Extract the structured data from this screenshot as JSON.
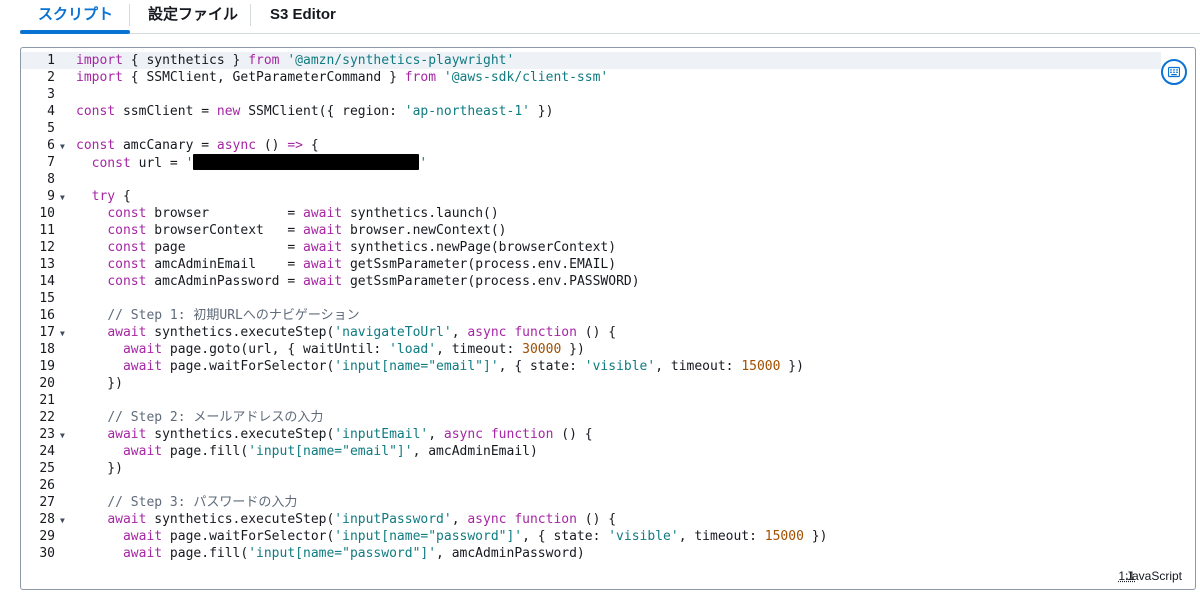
{
  "tabs": [
    {
      "label": "スクリプト",
      "active": true
    },
    {
      "label": "設定ファイル",
      "active": false
    },
    {
      "label": "S3 Editor",
      "active": false
    }
  ],
  "editor": {
    "lines": [
      {
        "n": "1",
        "fold": false,
        "parts": [
          [
            "kw",
            "import"
          ],
          [
            "p",
            " { synthetics } "
          ],
          [
            "kw",
            "from"
          ],
          [
            "p",
            " "
          ],
          [
            "str",
            "'@amzn/synthetics-playwright'"
          ]
        ]
      },
      {
        "n": "2",
        "fold": false,
        "parts": [
          [
            "kw",
            "import"
          ],
          [
            "p",
            " { SSMClient, GetParameterCommand } "
          ],
          [
            "kw",
            "from"
          ],
          [
            "p",
            " "
          ],
          [
            "str",
            "'@aws-sdk/client-ssm'"
          ]
        ]
      },
      {
        "n": "3",
        "fold": false,
        "parts": []
      },
      {
        "n": "4",
        "fold": false,
        "parts": [
          [
            "kw",
            "const"
          ],
          [
            "p",
            " ssmClient = "
          ],
          [
            "kw",
            "new"
          ],
          [
            "p",
            " SSMClient({ region: "
          ],
          [
            "str",
            "'ap-northeast-1'"
          ],
          [
            "p",
            " })"
          ]
        ]
      },
      {
        "n": "5",
        "fold": false,
        "parts": []
      },
      {
        "n": "6",
        "fold": true,
        "parts": [
          [
            "kw",
            "const"
          ],
          [
            "p",
            " amcCanary = "
          ],
          [
            "kw",
            "async"
          ],
          [
            "p",
            " () "
          ],
          [
            "kw",
            "=>"
          ],
          [
            "p",
            " {"
          ]
        ]
      },
      {
        "n": "7",
        "fold": false,
        "parts": [
          [
            "p",
            "  "
          ],
          [
            "kw",
            "const"
          ],
          [
            "p",
            " url = "
          ],
          [
            "str",
            "'"
          ],
          [
            "redact",
            ""
          ],
          [
            "str",
            "'"
          ]
        ]
      },
      {
        "n": "8",
        "fold": false,
        "parts": []
      },
      {
        "n": "9",
        "fold": true,
        "parts": [
          [
            "p",
            "  "
          ],
          [
            "kw",
            "try"
          ],
          [
            "p",
            " {"
          ]
        ]
      },
      {
        "n": "10",
        "fold": false,
        "parts": [
          [
            "p",
            "    "
          ],
          [
            "kw",
            "const"
          ],
          [
            "p",
            " browser          = "
          ],
          [
            "kw",
            "await"
          ],
          [
            "p",
            " synthetics.launch()"
          ]
        ]
      },
      {
        "n": "11",
        "fold": false,
        "parts": [
          [
            "p",
            "    "
          ],
          [
            "kw",
            "const"
          ],
          [
            "p",
            " browserContext   = "
          ],
          [
            "kw",
            "await"
          ],
          [
            "p",
            " browser.newContext()"
          ]
        ]
      },
      {
        "n": "12",
        "fold": false,
        "parts": [
          [
            "p",
            "    "
          ],
          [
            "kw",
            "const"
          ],
          [
            "p",
            " page             = "
          ],
          [
            "kw",
            "await"
          ],
          [
            "p",
            " synthetics.newPage(browserContext)"
          ]
        ]
      },
      {
        "n": "13",
        "fold": false,
        "parts": [
          [
            "p",
            "    "
          ],
          [
            "kw",
            "const"
          ],
          [
            "p",
            " amcAdminEmail    = "
          ],
          [
            "kw",
            "await"
          ],
          [
            "p",
            " getSsmParameter(process.env.EMAIL)"
          ]
        ]
      },
      {
        "n": "14",
        "fold": false,
        "parts": [
          [
            "p",
            "    "
          ],
          [
            "kw",
            "const"
          ],
          [
            "p",
            " amcAdminPassword = "
          ],
          [
            "kw",
            "await"
          ],
          [
            "p",
            " getSsmParameter(process.env.PASSWORD)"
          ]
        ]
      },
      {
        "n": "15",
        "fold": false,
        "parts": []
      },
      {
        "n": "16",
        "fold": false,
        "parts": [
          [
            "p",
            "    "
          ],
          [
            "cm",
            "// Step 1: 初期URLへのナビゲーション"
          ]
        ]
      },
      {
        "n": "17",
        "fold": true,
        "parts": [
          [
            "p",
            "    "
          ],
          [
            "kw",
            "await"
          ],
          [
            "p",
            " synthetics.executeStep("
          ],
          [
            "str",
            "'navigateToUrl'"
          ],
          [
            "p",
            ", "
          ],
          [
            "kw",
            "async"
          ],
          [
            "p",
            " "
          ],
          [
            "kw",
            "function"
          ],
          [
            "p",
            " () {"
          ]
        ]
      },
      {
        "n": "18",
        "fold": false,
        "parts": [
          [
            "p",
            "      "
          ],
          [
            "kw",
            "await"
          ],
          [
            "p",
            " page.goto(url, { waitUntil: "
          ],
          [
            "str",
            "'load'"
          ],
          [
            "p",
            ", timeout: "
          ],
          [
            "num",
            "30000"
          ],
          [
            "p",
            " })"
          ]
        ]
      },
      {
        "n": "19",
        "fold": false,
        "parts": [
          [
            "p",
            "      "
          ],
          [
            "kw",
            "await"
          ],
          [
            "p",
            " page.waitForSelector("
          ],
          [
            "str",
            "'input[name=\"email\"]'"
          ],
          [
            "p",
            ", { state: "
          ],
          [
            "str",
            "'visible'"
          ],
          [
            "p",
            ", timeout: "
          ],
          [
            "num",
            "15000"
          ],
          [
            "p",
            " })"
          ]
        ]
      },
      {
        "n": "20",
        "fold": false,
        "parts": [
          [
            "p",
            "    })"
          ]
        ]
      },
      {
        "n": "21",
        "fold": false,
        "parts": []
      },
      {
        "n": "22",
        "fold": false,
        "parts": [
          [
            "p",
            "    "
          ],
          [
            "cm",
            "// Step 2: メールアドレスの入力"
          ]
        ]
      },
      {
        "n": "23",
        "fold": true,
        "parts": [
          [
            "p",
            "    "
          ],
          [
            "kw",
            "await"
          ],
          [
            "p",
            " synthetics.executeStep("
          ],
          [
            "str",
            "'inputEmail'"
          ],
          [
            "p",
            ", "
          ],
          [
            "kw",
            "async"
          ],
          [
            "p",
            " "
          ],
          [
            "kw",
            "function"
          ],
          [
            "p",
            " () {"
          ]
        ]
      },
      {
        "n": "24",
        "fold": false,
        "parts": [
          [
            "p",
            "      "
          ],
          [
            "kw",
            "await"
          ],
          [
            "p",
            " page.fill("
          ],
          [
            "str",
            "'input[name=\"email\"]'"
          ],
          [
            "p",
            ", amcAdminEmail)"
          ]
        ]
      },
      {
        "n": "25",
        "fold": false,
        "parts": [
          [
            "p",
            "    })"
          ]
        ]
      },
      {
        "n": "26",
        "fold": false,
        "parts": []
      },
      {
        "n": "27",
        "fold": false,
        "parts": [
          [
            "p",
            "    "
          ],
          [
            "cm",
            "// Step 3: パスワードの入力"
          ]
        ]
      },
      {
        "n": "28",
        "fold": true,
        "parts": [
          [
            "p",
            "    "
          ],
          [
            "kw",
            "await"
          ],
          [
            "p",
            " synthetics.executeStep("
          ],
          [
            "str",
            "'inputPassword'"
          ],
          [
            "p",
            ", "
          ],
          [
            "kw",
            "async"
          ],
          [
            "p",
            " "
          ],
          [
            "kw",
            "function"
          ],
          [
            "p",
            " () {"
          ]
        ]
      },
      {
        "n": "29",
        "fold": false,
        "parts": [
          [
            "p",
            "      "
          ],
          [
            "kw",
            "await"
          ],
          [
            "p",
            " page.waitForSelector("
          ],
          [
            "str",
            "'input[name=\"password\"]'"
          ],
          [
            "p",
            ", { state: "
          ],
          [
            "str",
            "'visible'"
          ],
          [
            "p",
            ", timeout: "
          ],
          [
            "num",
            "15000"
          ],
          [
            "p",
            " })"
          ]
        ]
      },
      {
        "n": "30",
        "fold": false,
        "parts": [
          [
            "p",
            "      "
          ],
          [
            "kw",
            "await"
          ],
          [
            "p",
            " page.fill("
          ],
          [
            "str",
            "'input[name=\"password\"]'"
          ],
          [
            "p",
            ", amcAdminPassword)"
          ]
        ]
      }
    ],
    "highlighted_line": "1",
    "settings_icon": "keyboard-settings-icon",
    "status": {
      "cursor": "1:1",
      "language": "JavaScript"
    }
  },
  "colors": {
    "accent": "#0972d3",
    "keyword": "#a626a4",
    "string": "#0f7b81",
    "number": "#a14f00",
    "comment": "#5f6b7a"
  }
}
